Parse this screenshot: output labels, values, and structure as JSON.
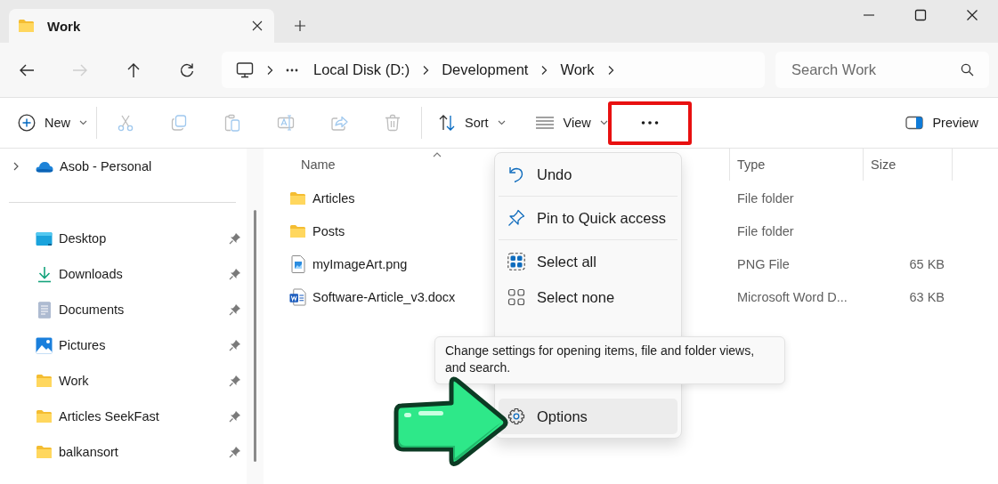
{
  "tabs": [
    {
      "label": "Work",
      "selected": true
    }
  ],
  "navigation": [
    {
      "disabled": false
    },
    {
      "disabled": true
    },
    {
      "disabled": false
    },
    {
      "disabled": false
    }
  ],
  "address_bar": {
    "path": [
      "Local Disk (D:)",
      "Development",
      "Work"
    ]
  },
  "search": {
    "placeholder": "Search Work"
  },
  "toolbar": {
    "new": {
      "label": "New"
    },
    "actions": [
      {
        "disabled": true
      },
      {
        "disabled": true
      },
      {
        "disabled": true
      },
      {
        "disabled": true
      },
      {
        "disabled": true
      },
      {
        "disabled": true
      }
    ],
    "sort": {
      "label": "Sort"
    },
    "view": {
      "label": "View"
    },
    "more": {
      "highlighted": true
    },
    "preview": {
      "label": "Preview"
    }
  },
  "sidebar": {
    "account": {
      "label": "Asob - Personal",
      "expanded": false
    },
    "items": [
      {
        "kind": "desktop",
        "label": "Desktop",
        "pinned": true
      },
      {
        "kind": "downloads",
        "label": "Downloads",
        "pinned": true
      },
      {
        "kind": "documents",
        "label": "Documents",
        "pinned": true
      },
      {
        "kind": "pictures",
        "label": "Pictures",
        "pinned": true
      },
      {
        "kind": "folder",
        "label": "Work",
        "pinned": true
      },
      {
        "kind": "folder",
        "label": "Articles SeekFast",
        "pinned": true
      },
      {
        "kind": "folder",
        "label": "balkansort",
        "pinned": true
      }
    ]
  },
  "columns": [
    {
      "label": "Name",
      "sorted": true
    },
    {
      "label": "Type",
      "sorted": false
    },
    {
      "label": "Size",
      "sorted": false
    }
  ],
  "files": [
    {
      "kind": "folder",
      "name": "Articles",
      "type": "File folder"
    },
    {
      "kind": "folder",
      "name": "Posts",
      "type": "File folder"
    },
    {
      "kind": "image",
      "name": "myImageArt.png",
      "type": "PNG File",
      "size": "65 KB"
    },
    {
      "kind": "word",
      "name": "Software-Article_v3.docx",
      "type": "Microsoft Word D...",
      "size": "63 KB"
    }
  ],
  "menu": {
    "groups": [
      [
        {
          "kind": "undo",
          "label": "Undo",
          "highlighted": false
        }
      ],
      [
        {
          "kind": "pin",
          "label": "Pin to Quick access",
          "highlighted": false
        }
      ],
      [
        {
          "kind": "select-all",
          "label": "Select all",
          "highlighted": false
        },
        {
          "kind": "select-none",
          "label": "Select none",
          "highlighted": false
        }
      ],
      [
        {
          "kind": "options",
          "label": "Options",
          "highlighted": true
        }
      ]
    ]
  },
  "tooltip": {
    "text": "Change settings for opening items, file and folder views, and search."
  }
}
